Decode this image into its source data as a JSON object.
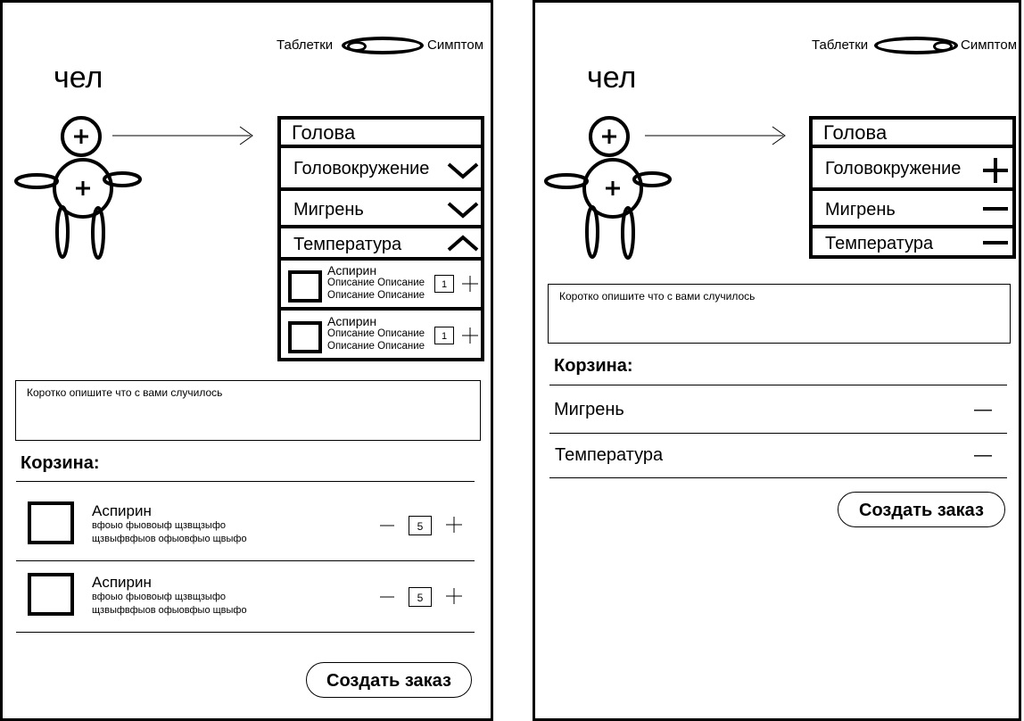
{
  "screens": [
    {
      "toggle": {
        "left_label": "Таблетки",
        "right_label": "Симптом",
        "state": "Таблетки"
      },
      "figure_label": "чел",
      "symptoms_panel": {
        "title": "Голова",
        "items": [
          {
            "label": "Головокружение",
            "control": "chevron-down-icon"
          },
          {
            "label": "Мигрень",
            "control": "chevron-down-icon"
          },
          {
            "label": "Температура",
            "control": "chevron-up-icon"
          }
        ],
        "medicines": [
          {
            "name": "Аспирин",
            "description": "Описание Описание Описание Описание",
            "quantity": "1"
          },
          {
            "name": "Аспирин",
            "description": "Описание Описание Описание Описание",
            "quantity": "1"
          }
        ]
      },
      "description_placeholder": "Коротко опишите что с вами случилось",
      "cart": {
        "title": "Корзина:",
        "items": [
          {
            "name": "Аспирин",
            "description": "вфоыо фыовоыф щзвщзыфо щзвыфвфыов офыовфыо щвыфо",
            "quantity": "5"
          },
          {
            "name": "Аспирин",
            "description": "вфоыо фыовоыф щзвщзыфо щзвыфвфыов офыовфыо щвыфо",
            "quantity": "5"
          }
        ]
      },
      "order_button": "Создать заказ"
    },
    {
      "toggle": {
        "left_label": "Таблетки",
        "right_label": "Симптом",
        "state": "Симптом"
      },
      "figure_label": "чел",
      "symptoms_panel": {
        "title": "Голова",
        "items": [
          {
            "label": "Головокружение",
            "control": "plus-icon"
          },
          {
            "label": "Мигрень",
            "control": "minus-icon"
          },
          {
            "label": "Температура",
            "control": "minus-icon"
          }
        ]
      },
      "description_placeholder": "Коротко опишите что с вами случилось",
      "cart": {
        "title": "Корзина:",
        "items": [
          {
            "label": "Мигрень",
            "control": "—"
          },
          {
            "label": "Температура",
            "control": "—"
          }
        ]
      },
      "order_button": "Создать заказ"
    }
  ]
}
